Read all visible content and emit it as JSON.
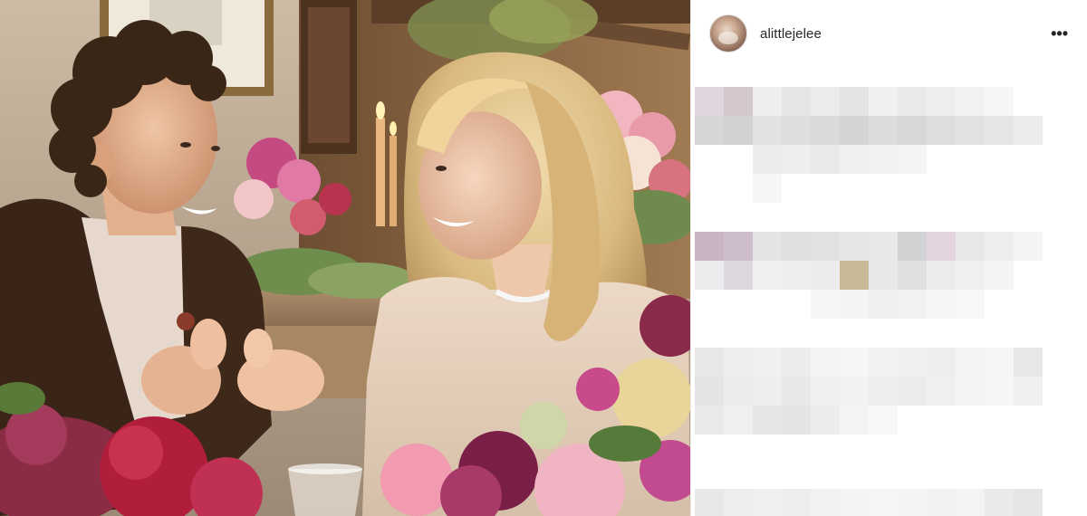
{
  "post": {
    "username": "alittlejelee",
    "more_icon": "more-horizontal-icon",
    "more_glyph": "•••",
    "caption_blurred": true
  },
  "photo": {
    "subject": "photo"
  },
  "colors": {
    "sidebar_bg": "#ffffff",
    "username_color": "#262626",
    "border": "#efefef"
  }
}
